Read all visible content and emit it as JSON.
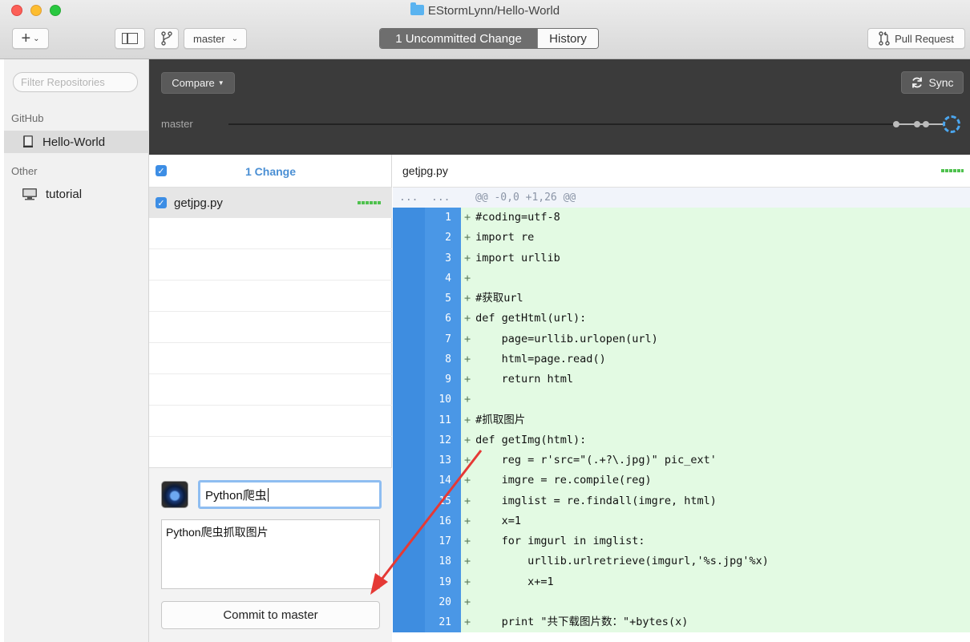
{
  "window": {
    "title": "EStormLynn/Hello-World"
  },
  "toolbar": {
    "add_label": "+",
    "branch": "master",
    "tabs": [
      {
        "label": "1 Uncommitted Change",
        "active": true
      },
      {
        "label": "History",
        "active": false
      }
    ],
    "pull_request": "Pull Request"
  },
  "sidebar": {
    "filter_placeholder": "Filter Repositories",
    "sections": [
      {
        "label": "GitHub",
        "items": [
          {
            "name": "Hello-World",
            "selected": true
          }
        ]
      },
      {
        "label": "Other",
        "items": [
          {
            "name": "tutorial",
            "selected": false
          }
        ]
      }
    ]
  },
  "header": {
    "compare_label": "Compare",
    "sync_label": "Sync",
    "branch_label": "master"
  },
  "changes": {
    "count_label": "1 Change",
    "files": [
      {
        "name": "getjpg.py",
        "checked": true
      }
    ]
  },
  "commit": {
    "summary": "Python爬虫",
    "description": "Python爬虫抓取图片",
    "button": "Commit to master"
  },
  "diff": {
    "filename": "getjpg.py",
    "hunk_dots_left": "...",
    "hunk_dots_right": "...",
    "hunk_header": "@@ -0,0 +1,26 @@",
    "lines": [
      {
        "num": "1",
        "text": "#coding=utf-8"
      },
      {
        "num": "2",
        "text": "import re"
      },
      {
        "num": "3",
        "text": "import urllib"
      },
      {
        "num": "4",
        "text": ""
      },
      {
        "num": "5",
        "text": "#获取url"
      },
      {
        "num": "6",
        "text": "def getHtml(url):"
      },
      {
        "num": "7",
        "text": "    page=urllib.urlopen(url)"
      },
      {
        "num": "8",
        "text": "    html=page.read()"
      },
      {
        "num": "9",
        "text": "    return html"
      },
      {
        "num": "10",
        "text": ""
      },
      {
        "num": "11",
        "text": "#抓取图片"
      },
      {
        "num": "12",
        "text": "def getImg(html):"
      },
      {
        "num": "13",
        "text": "    reg = r'src=\"(.+?\\.jpg)\" pic_ext'"
      },
      {
        "num": "14",
        "text": "    imgre = re.compile(reg)"
      },
      {
        "num": "15",
        "text": "    imglist = re.findall(imgre, html)"
      },
      {
        "num": "16",
        "text": "    x=1"
      },
      {
        "num": "17",
        "text": "    for imgurl in imglist:"
      },
      {
        "num": "18",
        "text": "        urllib.urlretrieve(imgurl,'%s.jpg'%x)"
      },
      {
        "num": "19",
        "text": "        x+=1"
      },
      {
        "num": "20",
        "text": ""
      },
      {
        "num": "21",
        "text": "    print \"共下载图片数：\"+bytes(x)"
      }
    ]
  },
  "colors": {
    "accent": "#3e8de0",
    "added_bg": "#e3fae3",
    "dark_header": "#3b3b3b",
    "annotation_arrow": "#e53935"
  }
}
